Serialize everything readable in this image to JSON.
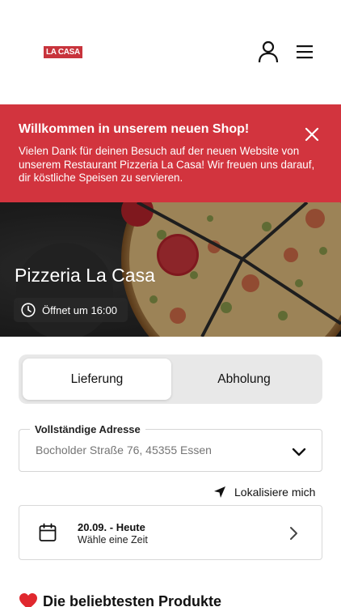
{
  "header": {
    "logo_text": "LA CASA",
    "icons": {
      "account": "user-icon",
      "menu": "hamburger-menu-icon"
    }
  },
  "banner": {
    "title": "Willkommen in unserem neuen Shop!",
    "text": "Vielen Dank für deinen Besuch auf der neuen Website von unserem Restaurant Pizzeria La Casa! Wir freuen uns darauf, dir köstliche Speisen zu servieren.",
    "close_icon": "close-icon",
    "color": "#d2343e"
  },
  "hero": {
    "title": "Pizzeria La Casa",
    "opening_text": "Öffnet um 16:00",
    "clock_icon": "clock-icon"
  },
  "order_type": {
    "options": [
      "Lieferung",
      "Abholung"
    ],
    "selected": "Lieferung"
  },
  "address": {
    "label": "Vollständige Adresse",
    "placeholder": "Bocholder Straße 76, 45355 Essen",
    "chevron_icon": "chevron-down-icon"
  },
  "locate": {
    "label": "Lokalisiere mich",
    "icon": "location-arrow-icon"
  },
  "time": {
    "date": "20.09. - Heute",
    "subtitle": "Wähle eine Zeit",
    "calendar_icon": "calendar-icon",
    "chevron_icon": "chevron-right-icon"
  },
  "popular": {
    "title": "Die beliebtesten Produkte",
    "icon": "heart-icon",
    "icon_color": "#e0282e"
  }
}
